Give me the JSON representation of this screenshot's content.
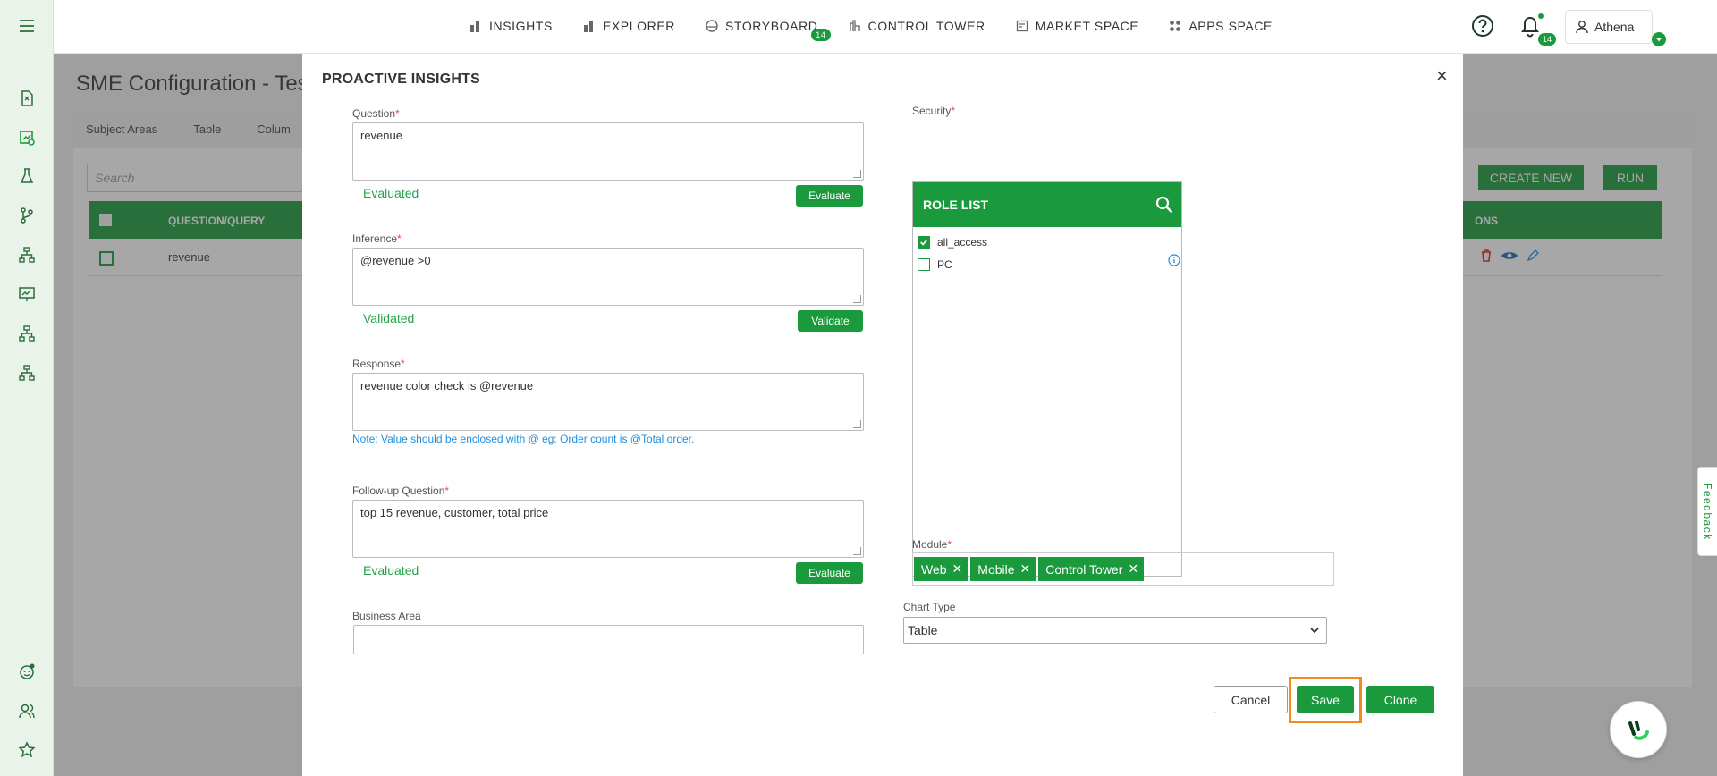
{
  "nav": {
    "items": [
      {
        "label": "INSIGHTS",
        "icon": "bar-chart-icon"
      },
      {
        "label": "EXPLORER",
        "icon": "bar-chart-icon"
      },
      {
        "label": "STORYBOARD",
        "icon": "storyboard-icon",
        "badge": "14"
      },
      {
        "label": "CONTROL TOWER",
        "icon": "tower-icon"
      },
      {
        "label": "MARKET SPACE",
        "icon": "market-icon"
      },
      {
        "label": "APPS SPACE",
        "icon": "apps-grid-icon"
      }
    ],
    "notification_count": "14",
    "user_name": "Athena"
  },
  "sidebar": {
    "items": [
      "menu-icon",
      "report-icon",
      "insights-icon",
      "lab-flask-icon",
      "git-branch-icon",
      "hierarchy-icon",
      "presentation-icon",
      "sitemap-icon",
      "sitemap-alt-icon",
      "feedback-face-icon",
      "user-group-icon",
      "star-icon",
      "expand-chevron-icon"
    ]
  },
  "background": {
    "title": "SME Configuration - Tes",
    "tabs": [
      "Subject Areas",
      "Table",
      "Colum"
    ],
    "search_placeholder": "Search",
    "create_new": "CREATE NEW",
    "run": "RUN",
    "col_question": "QUESTION/QUERY",
    "col_actions": "ONS",
    "row_question": "revenue"
  },
  "modal": {
    "title": "PROACTIVE INSIGHTS",
    "question": {
      "label": "Question",
      "value": "revenue",
      "status": "Evaluated",
      "button": "Evaluate"
    },
    "inference": {
      "label": "Inference",
      "value": "@revenue >0",
      "status": "Validated",
      "button": "Validate"
    },
    "response": {
      "label": "Response",
      "value": "revenue color check is @revenue",
      "note": "Note: Value should be enclosed with @ eg: Order count is @Total order."
    },
    "followup": {
      "label": "Follow-up Question",
      "value": "top 15 revenue, customer, total price",
      "status": "Evaluated",
      "button": "Evaluate"
    },
    "business_area": {
      "label": "Business Area",
      "value": ""
    },
    "security": {
      "label": "Security",
      "list_title": "ROLE LIST",
      "roles": [
        {
          "name": "all_access",
          "checked": true
        },
        {
          "name": "PC",
          "checked": false
        }
      ]
    },
    "module": {
      "label": "Module",
      "tags": [
        "Web",
        "Mobile",
        "Control Tower"
      ]
    },
    "chart_type": {
      "label": "Chart Type",
      "value": "Table"
    },
    "buttons": {
      "cancel": "Cancel",
      "save": "Save",
      "clone": "Clone"
    }
  },
  "feedback_label": "Feedback",
  "colors": {
    "primary": "#1a9a3c",
    "highlight": "#f28a1e",
    "note": "#1f8fe3",
    "status": "#27a24a"
  }
}
